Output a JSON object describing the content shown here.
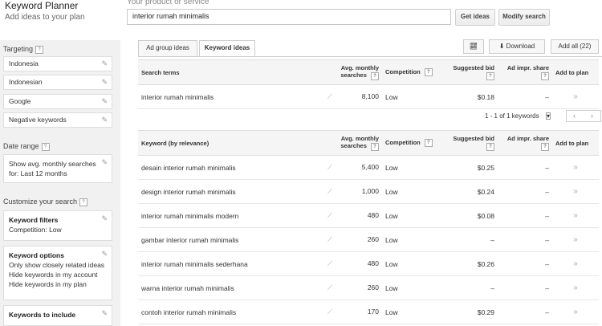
{
  "header": {
    "title": "Keyword Planner",
    "subtitle": "Add ideas to your plan",
    "product_label": "Your product or service",
    "search_value": "interior rumah minimalis",
    "get_ideas": "Get ideas",
    "modify_search": "Modify search"
  },
  "sidebar": {
    "targeting_label": "Targeting",
    "targeting_items": [
      "Indonesia",
      "Indonesian",
      "Google",
      "Negative keywords"
    ],
    "date_range_label": "Date range",
    "date_range_value": "Show avg. monthly searches for: Last 12 months",
    "customize_label": "Customize your search",
    "keyword_filters": {
      "title": "Keyword filters",
      "value": "Competition: Low"
    },
    "keyword_options": {
      "title": "Keyword options",
      "lines": [
        "Only show closely related ideas",
        "Hide keywords in my account",
        "Hide keywords in my plan"
      ]
    },
    "keywords_to_include": "Keywords to include"
  },
  "tabs": {
    "ad_group_ideas": "Ad group ideas",
    "keyword_ideas": "Keyword ideas"
  },
  "toolbar": {
    "download": "Download",
    "add_all": "Add all (22)"
  },
  "search_terms_table": {
    "headers": {
      "term": "Search terms",
      "avg": "Avg. monthly searches",
      "competition": "Competition",
      "bid": "Suggested bid",
      "share": "Ad impr. share",
      "add": "Add to plan"
    },
    "rows": [
      {
        "keyword": "interior rumah minimalis",
        "searches": "8,100",
        "competition": "Low",
        "bid": "$0.18",
        "share": "–"
      }
    ]
  },
  "pager": {
    "text": "1 - 1 of 1 keywords"
  },
  "ideas_table": {
    "headers": {
      "term": "Keyword (by relevance)",
      "avg": "Avg. monthly searches",
      "competition": "Competition",
      "bid": "Suggested bid",
      "share": "Ad impr. share",
      "add": "Add to plan"
    },
    "rows": [
      {
        "keyword": "desain interior rumah minimalis",
        "searches": "5,400",
        "competition": "Low",
        "bid": "$0.25",
        "share": "–"
      },
      {
        "keyword": "design interior rumah minimalis",
        "searches": "1,000",
        "competition": "Low",
        "bid": "$0.24",
        "share": "–"
      },
      {
        "keyword": "interior rumah minimalis modern",
        "searches": "480",
        "competition": "Low",
        "bid": "$0.08",
        "share": "–"
      },
      {
        "keyword": "gambar interior rumah minimalis",
        "searches": "260",
        "competition": "Low",
        "bid": "–",
        "share": "–"
      },
      {
        "keyword": "interior rumah minimalis sederhana",
        "searches": "480",
        "competition": "Low",
        "bid": "$0.26",
        "share": "–"
      },
      {
        "keyword": "warna interior rumah minimalis",
        "searches": "260",
        "competition": "Low",
        "bid": "–",
        "share": "–"
      },
      {
        "keyword": "contoh interior rumah minimalis",
        "searches": "170",
        "competition": "Low",
        "bid": "$0.29",
        "share": "–"
      }
    ]
  }
}
